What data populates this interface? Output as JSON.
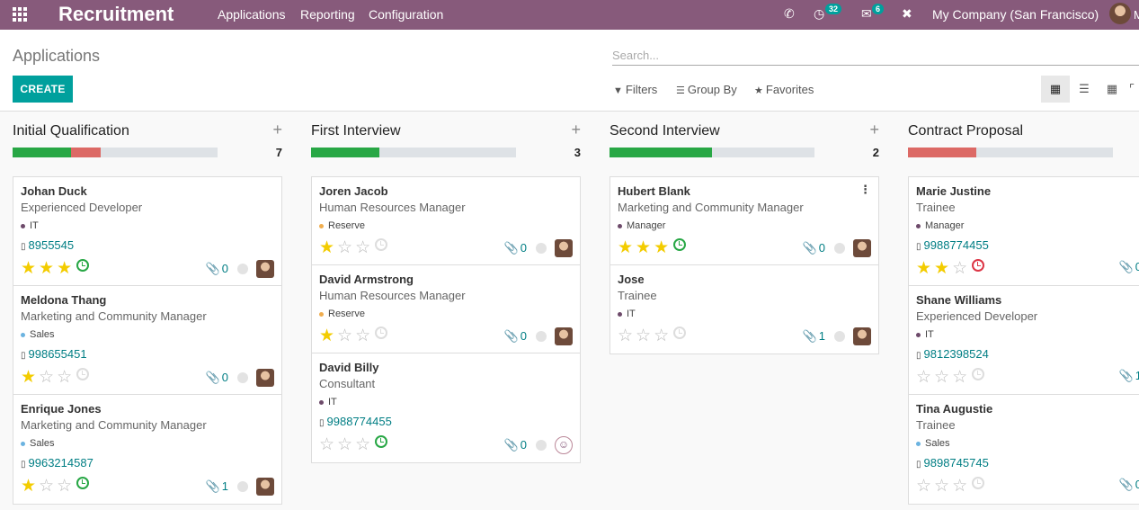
{
  "topbar": {
    "app_title": "Recruitment",
    "menus": [
      "Applications",
      "Reporting",
      "Configuration"
    ],
    "activity_count": "32",
    "message_count": "6",
    "company": "My Company (San Francisco)",
    "user_initial": "M"
  },
  "control": {
    "page_title": "Applications",
    "create_label": "CREATE",
    "search_placeholder": "Search...",
    "filters_label": "Filters",
    "groupby_label": "Group By",
    "favorites_label": "Favorites"
  },
  "columns": [
    {
      "title": "Initial Qualification",
      "count": "7",
      "progress_green": 0.285,
      "progress_red": 0.143,
      "cards": [
        {
          "name": "Johan Duck",
          "job": "Experienced Developer",
          "tag": "IT",
          "tag_color": "#6d4a6a",
          "phone": "8955545",
          "stars": 3,
          "activity": "green",
          "attachments": "0",
          "avatar": "person"
        },
        {
          "name": "Meldona Thang",
          "job": "Marketing and Community Manager",
          "tag": "Sales",
          "tag_color": "#6bb3e0",
          "phone": "998655451",
          "stars": 1,
          "activity": "grey",
          "attachments": "0",
          "avatar": "person"
        },
        {
          "name": "Enrique Jones",
          "job": "Marketing and Community Manager",
          "tag": "Sales",
          "tag_color": "#6bb3e0",
          "phone": "9963214587",
          "stars": 1,
          "activity": "green",
          "attachments": "1",
          "avatar": "person"
        }
      ]
    },
    {
      "title": "First Interview",
      "count": "3",
      "progress_green": 0.333,
      "progress_red": 0,
      "cards": [
        {
          "name": "Joren Jacob",
          "job": "Human Resources Manager",
          "tag": "Reserve",
          "tag_color": "#f0ad4e",
          "phone": "",
          "stars": 1,
          "activity": "grey",
          "attachments": "0",
          "avatar": "person"
        },
        {
          "name": "David Armstrong",
          "job": "Human Resources Manager",
          "tag": "Reserve",
          "tag_color": "#f0ad4e",
          "phone": "",
          "stars": 1,
          "activity": "grey",
          "attachments": "0",
          "avatar": "person"
        },
        {
          "name": "David Billy",
          "job": "Consultant",
          "tag": "IT",
          "tag_color": "#6d4a6a",
          "phone": "9988774455",
          "stars": 0,
          "activity": "green",
          "attachments": "0",
          "avatar": "smiley"
        }
      ]
    },
    {
      "title": "Second Interview",
      "count": "2",
      "progress_green": 0.5,
      "progress_red": 0,
      "cards": [
        {
          "name": "Hubert Blank",
          "job": "Marketing and Community Manager",
          "tag": "Manager",
          "tag_color": "#6d4a6a",
          "phone": "",
          "stars": 3,
          "activity": "green",
          "attachments": "0",
          "avatar": "person"
        },
        {
          "name": "Jose",
          "job": "Trainee",
          "tag": "IT",
          "tag_color": "#6d4a6a",
          "phone": "",
          "stars": 0,
          "activity": "grey",
          "attachments": "1",
          "avatar": "person"
        }
      ]
    },
    {
      "title": "Contract Proposal",
      "count": "",
      "progress_green": 0,
      "progress_red": 0.333,
      "cards": [
        {
          "name": "Marie Justine",
          "job": "Trainee",
          "tag": "Manager",
          "tag_color": "#6d4a6a",
          "phone": "9988774455",
          "stars": 2,
          "activity": "red",
          "attachments": "0",
          "avatar": "none"
        },
        {
          "name": "Shane Williams",
          "job": "Experienced Developer",
          "tag": "IT",
          "tag_color": "#6d4a6a",
          "phone": "9812398524",
          "stars": 0,
          "activity": "grey",
          "attachments": "1",
          "avatar": "none"
        },
        {
          "name": "Tina Augustie",
          "job": "Trainee",
          "tag": "Sales",
          "tag_color": "#6bb3e0",
          "phone": "9898745745",
          "stars": 0,
          "activity": "grey",
          "attachments": "0",
          "avatar": "none"
        }
      ]
    }
  ]
}
